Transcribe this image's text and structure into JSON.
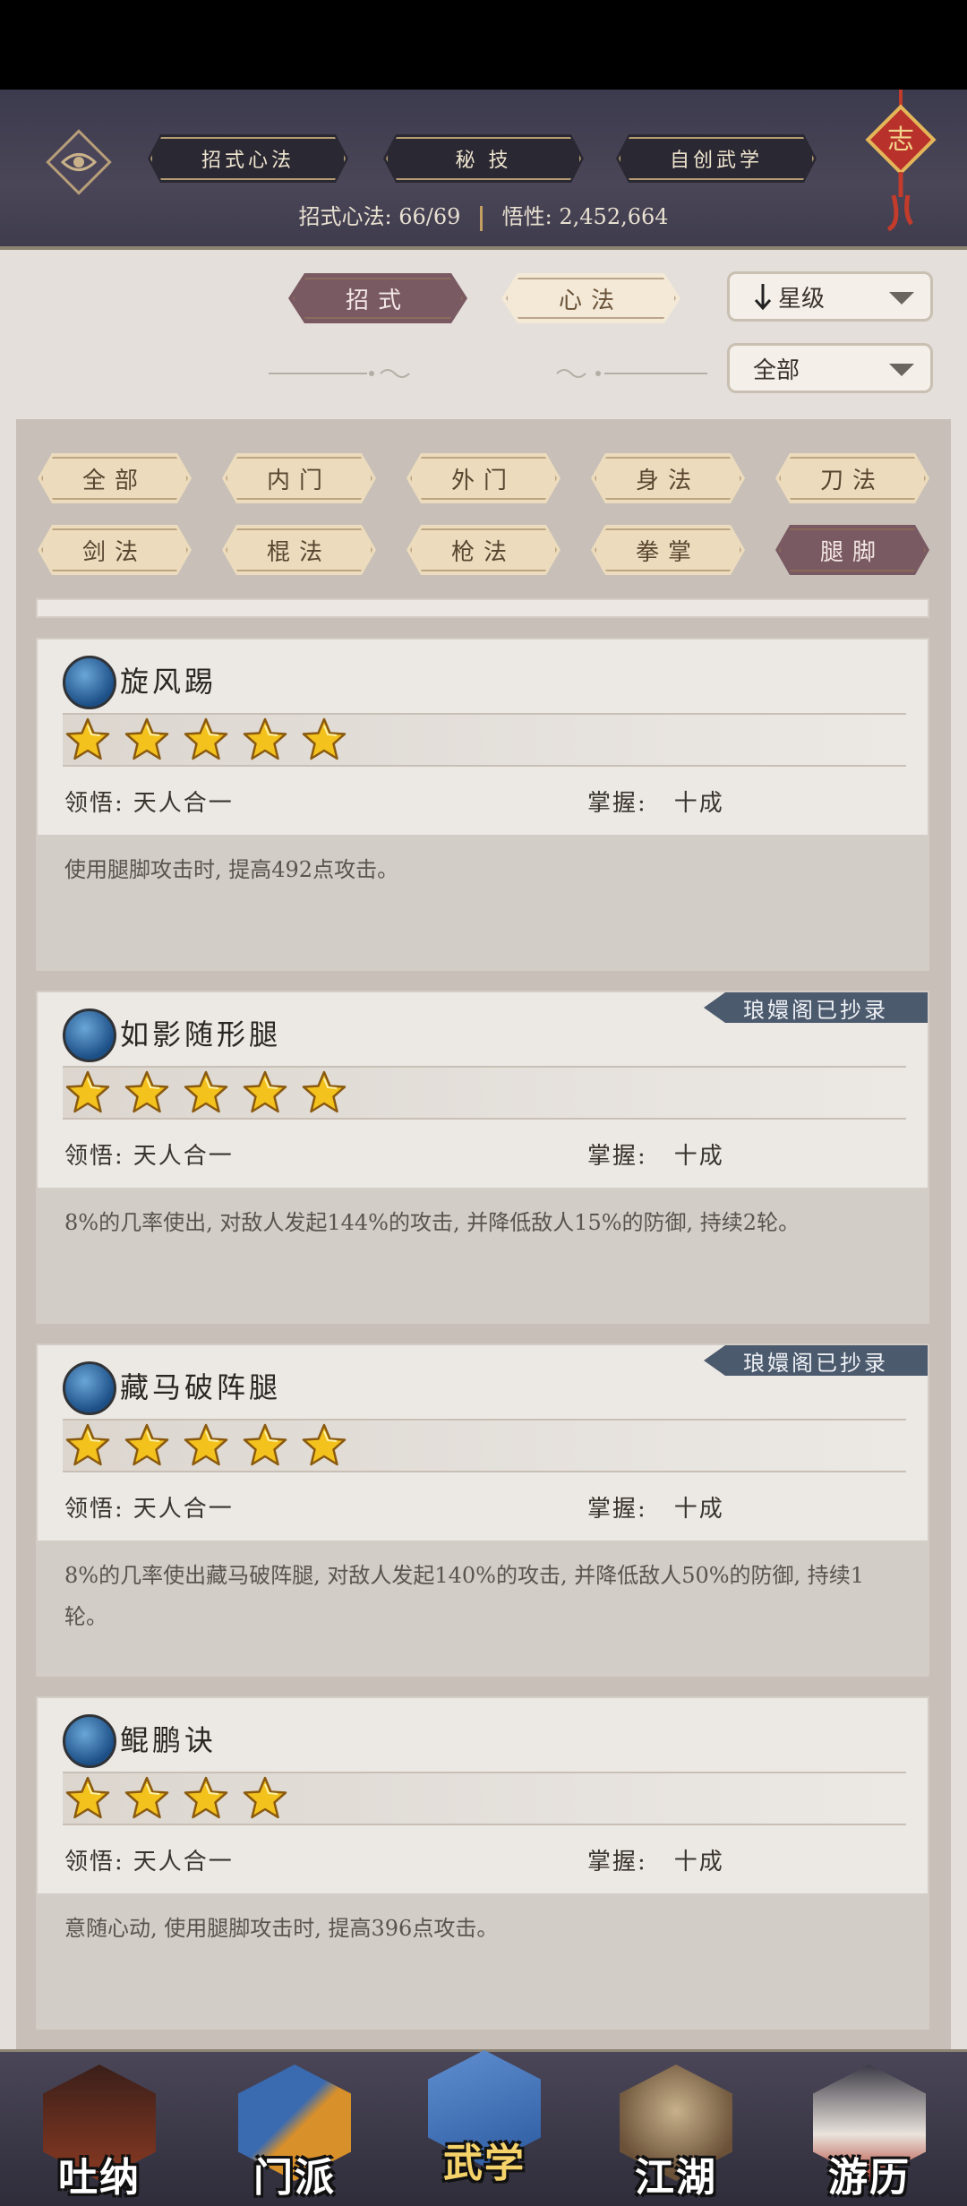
{
  "header": {
    "tabs": [
      {
        "label": "招式心法"
      },
      {
        "label": "秘 技"
      },
      {
        "label": "自创武学"
      }
    ],
    "stats": {
      "moves_label": "招式心法:",
      "moves_value": "66/69",
      "insight_label": "悟性:",
      "insight_value": "2,452,664"
    },
    "charm_text": "志"
  },
  "filter": {
    "segment": [
      {
        "label": "招式"
      },
      {
        "label": "心法"
      }
    ],
    "sort_dropdown": "星级",
    "scope_dropdown": "全部"
  },
  "categories": [
    {
      "label": "全部"
    },
    {
      "label": "内门"
    },
    {
      "label": "外门"
    },
    {
      "label": "身法"
    },
    {
      "label": "刀法"
    },
    {
      "label": "剑法"
    },
    {
      "label": "棍法"
    },
    {
      "label": "枪法"
    },
    {
      "label": "拳掌"
    },
    {
      "label": "腿脚"
    }
  ],
  "active_category": "腿脚",
  "skills": [
    {
      "name": "旋风踢",
      "stars": 5,
      "comprehension_label": "领悟:",
      "comprehension": "天人合一",
      "mastery_label": "掌握:",
      "mastery": "十成",
      "description": "使用腿脚攻击时, 提高492点攻击。",
      "tag": ""
    },
    {
      "name": "如影随形腿",
      "stars": 5,
      "comprehension_label": "领悟:",
      "comprehension": "天人合一",
      "mastery_label": "掌握:",
      "mastery": "十成",
      "description": "8%的几率使出, 对敌人发起144%的攻击, 并降低敌人15%的防御, 持续2轮。",
      "tag": "琅嬛阁已抄录"
    },
    {
      "name": "藏马破阵腿",
      "stars": 5,
      "comprehension_label": "领悟:",
      "comprehension": "天人合一",
      "mastery_label": "掌握:",
      "mastery": "十成",
      "description": "8%的几率使出藏马破阵腿, 对敌人发起140%的攻击, 并降低敌人50%的防御, 持续1轮。",
      "tag": "琅嬛阁已抄录"
    },
    {
      "name": "鲲鹏诀",
      "stars": 4,
      "comprehension_label": "领悟:",
      "comprehension": "天人合一",
      "mastery_label": "掌握:",
      "mastery": "十成",
      "description": "意随心动, 使用腿脚攻击时, 提高396点攻击。",
      "tag": ""
    }
  ],
  "nav": [
    {
      "label": "吐纳"
    },
    {
      "label": "门派"
    },
    {
      "label": "武学"
    },
    {
      "label": "江湖"
    },
    {
      "label": "游历"
    }
  ],
  "active_nav": "武学"
}
